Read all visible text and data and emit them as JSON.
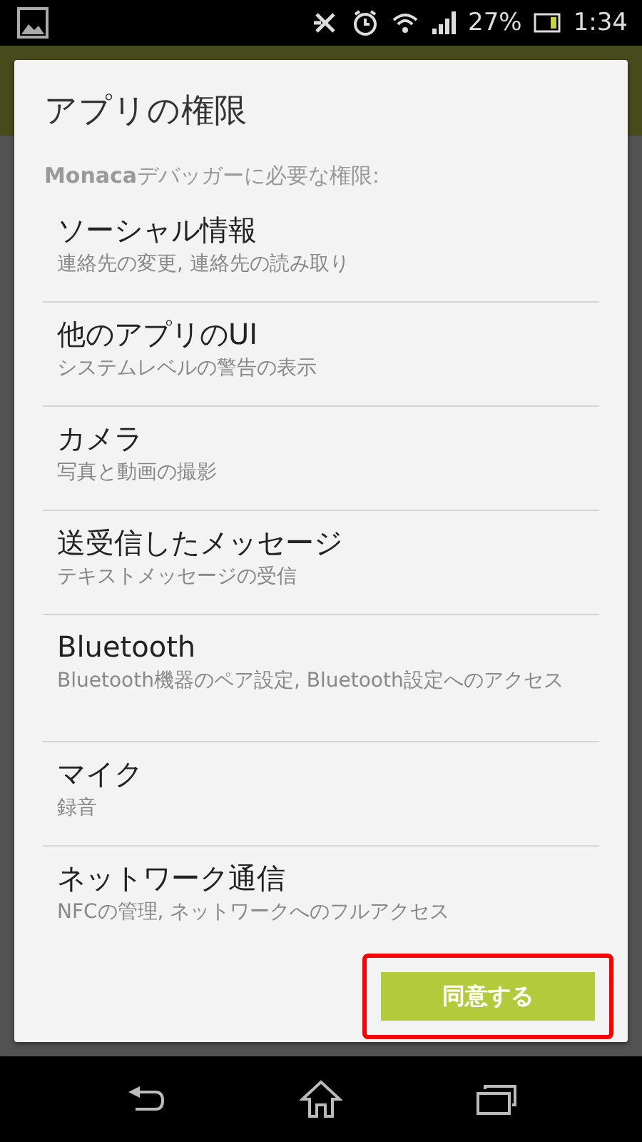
{
  "status_bar": {
    "battery": "27%",
    "time": "1:34"
  },
  "dialog": {
    "title": "アプリの権限",
    "subtitle_app": "Monaca",
    "subtitle_rest": "デバッガーに必要な権限:",
    "permissions": [
      {
        "name": "ソーシャル情報",
        "detail": "連絡先の変更, 連絡先の読み取り"
      },
      {
        "name": "他のアプリのUI",
        "detail": "システムレベルの警告の表示"
      },
      {
        "name": "カメラ",
        "detail": "写真と動画の撮影"
      },
      {
        "name": "送受信したメッセージ",
        "detail": "テキストメッセージの受信"
      },
      {
        "name": "Bluetooth",
        "detail": "Bluetooth機器のペア設定, Bluetooth設定へのアクセス"
      },
      {
        "name": "マイク",
        "detail": "録音"
      },
      {
        "name": "ネットワーク通信",
        "detail": "NFCの管理, ネットワークへのフルアクセス"
      }
    ],
    "button": "同意する"
  }
}
